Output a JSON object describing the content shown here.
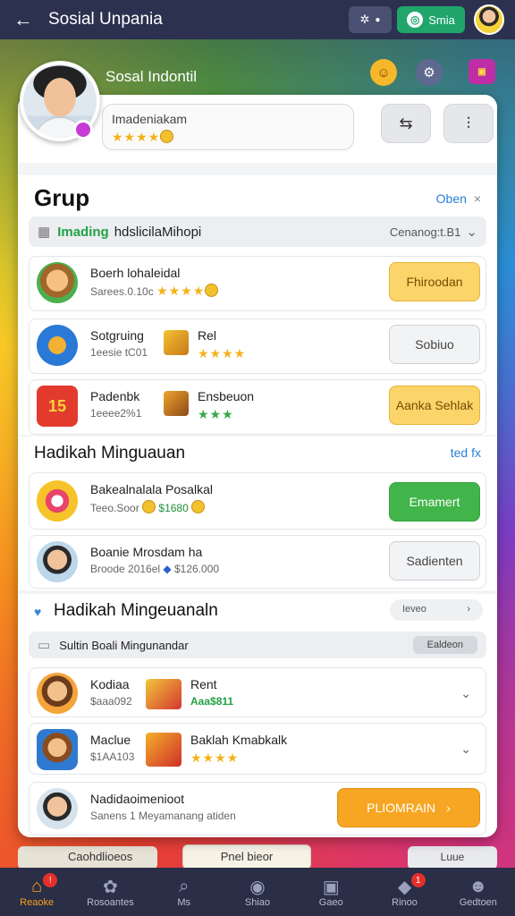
{
  "topbar": {
    "title": "Sosial Unpania",
    "chip_label": "Smia"
  },
  "profile": {
    "name": "Sosal Indontil",
    "search_value": "Imadeniakam"
  },
  "group": {
    "title": "Grup",
    "link": "Oben",
    "filter": {
      "green": "Imading",
      "rest": "hdslicilaMihopi",
      "right": "Cenanog:t.B1"
    },
    "rows": [
      {
        "title": "Boerh lohaleidal",
        "sub": "Sarees.0.10c",
        "button": "Fhiroodan"
      },
      {
        "title": "Sotgruing",
        "sub": "1eesie tC01",
        "mid_title": "Rel",
        "button": "Sobiuo"
      },
      {
        "title": "Padenbk",
        "sub": "1eeee2%1",
        "mid_title": "Ensbeuon",
        "button": "Aanka Sehlak"
      }
    ]
  },
  "weekly": {
    "title": "Hadikah Minguauan",
    "link": "ted fx",
    "rows": [
      {
        "title": "Bakealnalala Posalkal",
        "sub": "Teeo.Soor",
        "value": "$1680",
        "button": "Emamert"
      },
      {
        "title": "Boanie Mrosdam ha",
        "sub": "Broode 2016el",
        "value": "$126.000",
        "button": "Sadienten"
      }
    ]
  },
  "weekly2": {
    "title": "Hadikah Mingeuanaln",
    "pill": "Ieveo",
    "sub_bar": "Sultin Boali Mingunandar",
    "sub_bar_btn": "Ealdeon",
    "rows": [
      {
        "title": "Kodiaa",
        "sub": "$aaa092",
        "mid_title": "Rent",
        "mid_sub": "Aaa$811"
      },
      {
        "title": "Maclue",
        "sub": "$1AA103",
        "mid_title": "Baklah Kmabkalk"
      }
    ],
    "last": {
      "title": "Nadidaoimenioot",
      "sub": "Sanens 1 Meyamanang atiden",
      "button": "PLIOMRAIN"
    }
  },
  "peek": {
    "left": "Caohdlioeos",
    "pill": "Pnel bieor",
    "right": "Luue"
  },
  "nav": [
    {
      "label": "Reaoke",
      "icon": "home-icon"
    },
    {
      "label": "Rosoantes",
      "icon": "flower-icon"
    },
    {
      "label": "Ms",
      "icon": "search-icon"
    },
    {
      "label": "Shiao",
      "icon": "disc-icon"
    },
    {
      "label": "Gaeo",
      "icon": "gallery-icon"
    },
    {
      "label": "Rinoo",
      "icon": "tag-icon"
    },
    {
      "label": "Gedtoen",
      "icon": "person-icon"
    }
  ],
  "colors": {
    "accent_orange": "#f7a11c",
    "green": "#41b54a",
    "gold": "#fbd46a",
    "topbar": "#2c3150"
  }
}
